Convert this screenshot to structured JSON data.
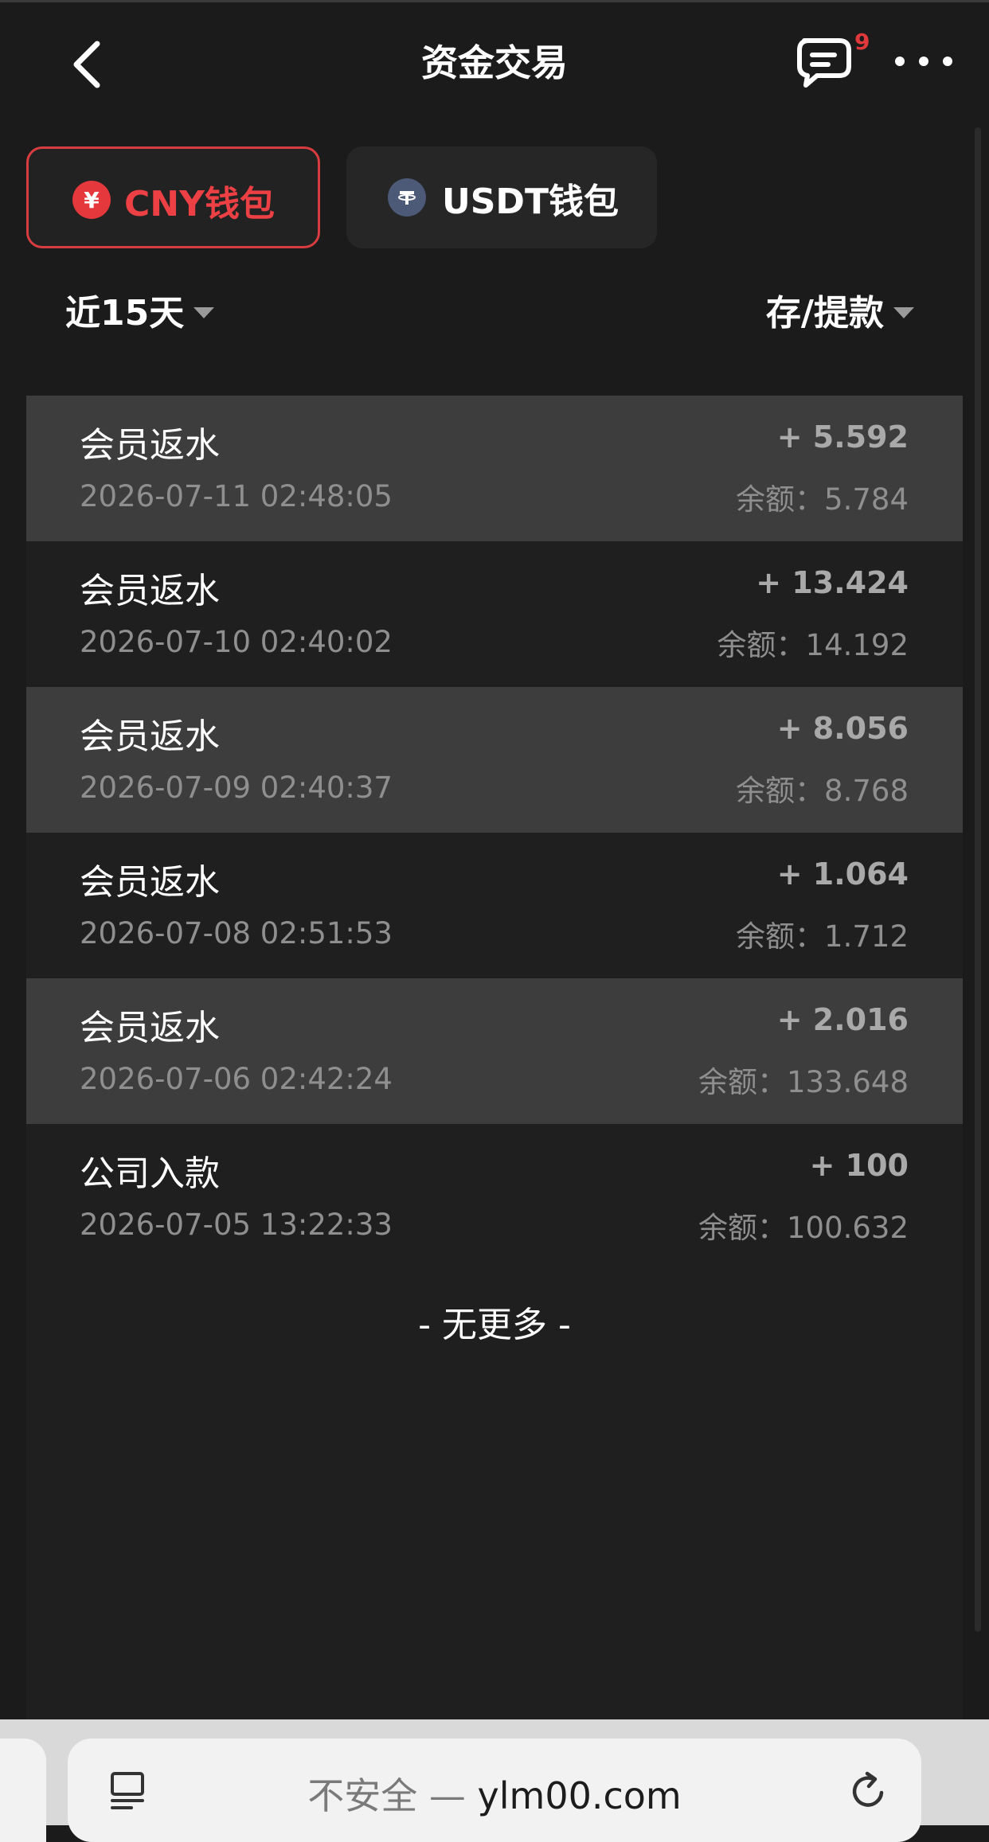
{
  "header": {
    "title": "资金交易",
    "message_badge": "9"
  },
  "wallet_tabs": [
    {
      "label": "CNY钱包",
      "icon": "yen-coin-icon",
      "symbol": "¥",
      "active": true
    },
    {
      "label": "USDT钱包",
      "icon": "tether-coin-icon",
      "active": false
    }
  ],
  "filters": {
    "range": "近15天",
    "type": "存/提款"
  },
  "transactions": [
    {
      "name": "会员返水",
      "time": "2026-07-11 02:48:05",
      "amount": "+ 5.592",
      "balance": "余额：5.784"
    },
    {
      "name": "会员返水",
      "time": "2026-07-10 02:40:02",
      "amount": "+ 13.424",
      "balance": "余额：14.192"
    },
    {
      "name": "会员返水",
      "time": "2026-07-09 02:40:37",
      "amount": "+ 8.056",
      "balance": "余额：8.768"
    },
    {
      "name": "会员返水",
      "time": "2026-07-08 02:51:53",
      "amount": "+ 1.064",
      "balance": "余额：1.712"
    },
    {
      "name": "会员返水",
      "time": "2026-07-06 02:42:24",
      "amount": "+ 2.016",
      "balance": "余额：133.648"
    },
    {
      "name": "公司入款",
      "time": "2026-07-05 13:22:33",
      "amount": "+ 100",
      "balance": "余额：100.632"
    }
  ],
  "no_more": "- 无更多 -",
  "browser": {
    "insecure_label": "不安全",
    "separator": " — ",
    "domain": "ylm00.com"
  },
  "colors": {
    "accent_red": "#ec4044",
    "background": "#1b1b1b",
    "row_alt": "#3d3d3d"
  }
}
